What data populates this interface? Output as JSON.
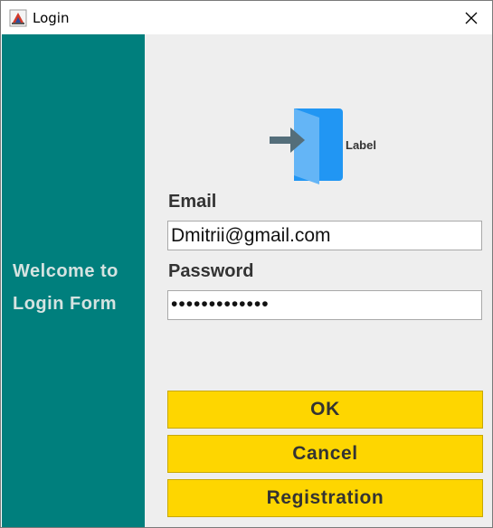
{
  "window": {
    "title": "Login",
    "app_icon": "java-app-icon",
    "close_icon": "close-icon"
  },
  "sidebar": {
    "background": "#007f7d",
    "welcome_line1": "Welcome to",
    "welcome_line2": "Login Form"
  },
  "form": {
    "logo_icon": "login-door-icon",
    "logo_label": "Label",
    "email_label": "Email",
    "email_value": "Dmitrii@gmail.com",
    "password_label": "Password",
    "password_mask": "•••••••••••••"
  },
  "buttons": {
    "ok_label": "OK",
    "cancel_label": "Cancel",
    "registration_label": "Registration",
    "color": "#fed600"
  }
}
